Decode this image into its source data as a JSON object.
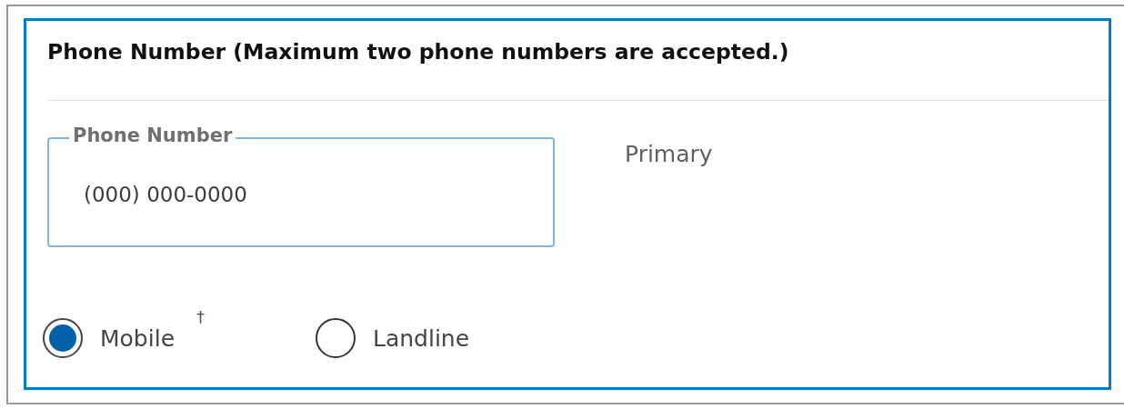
{
  "section": {
    "title": "Phone Number (Maximum two phone numbers are accepted.)"
  },
  "phone_field": {
    "label": "Phone Number",
    "value": "(000) 000-0000"
  },
  "primary_label": "Primary",
  "phone_types": [
    {
      "label": "Mobile",
      "note": "†",
      "selected": true
    },
    {
      "label": "Landline",
      "selected": false
    }
  ]
}
